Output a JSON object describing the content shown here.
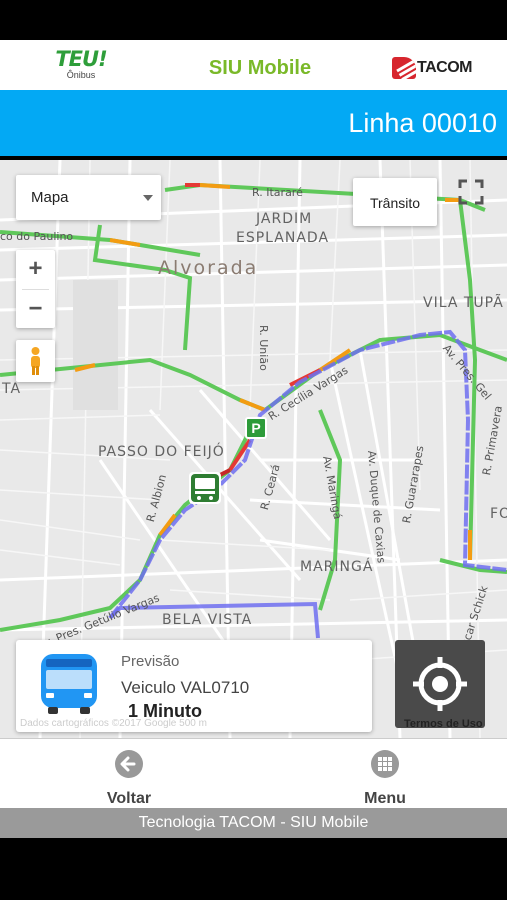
{
  "header": {
    "logo_left": "TEU!",
    "logo_left_sub": "Ônibus",
    "title": "SIU Mobile",
    "logo_right": "TACOM"
  },
  "line_bar": {
    "title": "Linha 00010",
    "color": "#03a9f4"
  },
  "map": {
    "type_selector": "Mapa",
    "transit_button": "Trânsito",
    "zoom_in": "+",
    "zoom_out": "−",
    "parking_label": "P",
    "labels": {
      "rItarare": "R. Itararé",
      "paulino": "co do Paulino",
      "jardim": "JARDIM",
      "esplanada": "ESPLANADA",
      "alvorada": "Alvorada",
      "vilaTupa": "VILA TUPÃ",
      "uniao": "R. União",
      "ta": "TA",
      "passoFeijo": "PASSO DO FEIJÓ",
      "albion": "R. Albion",
      "ceara": "R. Ceará",
      "maringaAv": "Av. Maringá",
      "duque": "Av. Duque de Caxias",
      "guararapes": "R. Guararapes",
      "primavera": "R. Primavera",
      "fo": "FO",
      "maringa": "MARINGÁ",
      "belaVista": "BELA VISTA",
      "oscar": "R. Oscar Schick",
      "getulio": "Av. Pres. Getúlio Vargas",
      "cecilia": "R. Cecília Vargas",
      "gel": "Av. Pres. Gel"
    },
    "attribution": "Dados cartográficos ©2017 Google   500 m",
    "terms": "Termos de Uso",
    "route_color": "#6f6ff0"
  },
  "prediction_card": {
    "label": "Previsão",
    "vehicle": "Veiculo VAL0710",
    "eta": "1 Minuto"
  },
  "bottom_nav": {
    "back_label": "Voltar",
    "menu_label": "Menu"
  },
  "footer": {
    "text": "Tecnologia TACOM - SIU Mobile"
  }
}
